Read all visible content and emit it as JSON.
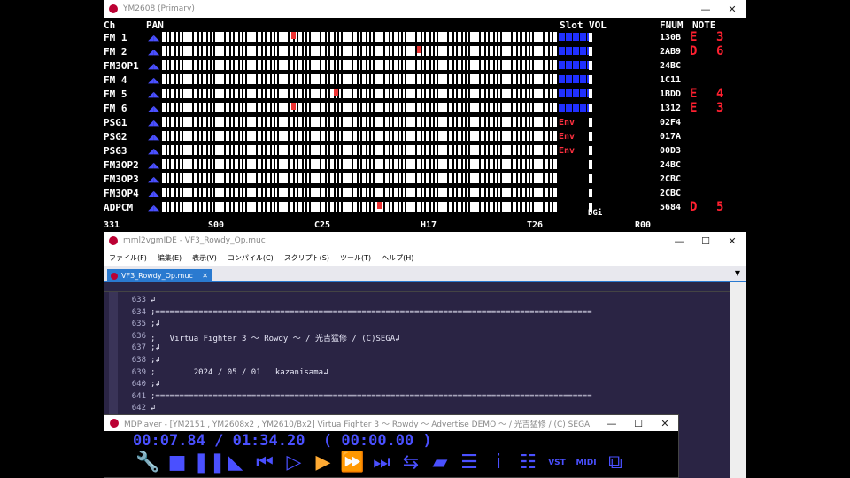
{
  "ym": {
    "title": "YM2608 (Primary)",
    "hdr_ch": "Ch",
    "hdr_pan": "PAN",
    "hdr_slot": "Slot",
    "hdr_vol": "VOL",
    "hdr_fnum": "FNUM",
    "hdr_note": "NOTE",
    "channels": [
      "FM 1",
      "FM 2",
      "FM3OP1",
      "FM 4",
      "FM 5",
      "FM 6",
      "PSG1",
      "PSG2",
      "PSG3",
      "FM3OP2",
      "FM3OP3",
      "FM3OP4",
      "ADPCM"
    ],
    "fnums": [
      "130B",
      "2AB9",
      "24BC",
      "1C11",
      "1BDD",
      "1312",
      "02F4",
      "017A",
      "00D3",
      "24BC",
      "2CBC",
      "2CBC",
      "5684"
    ],
    "notes": [
      "E",
      "D",
      "",
      "",
      "E",
      "E",
      "",
      "",
      "",
      "",
      "",
      "",
      "D"
    ],
    "octaves": [
      "3",
      "6",
      "",
      "",
      "4",
      "3",
      "",
      "",
      "",
      "",
      "",
      "",
      "5"
    ],
    "env": "Env",
    "dg": "DGi",
    "bottom": [
      "331",
      "S00",
      "C25",
      "H17",
      "T26",
      "R00"
    ]
  },
  "ide": {
    "title": "mml2vgmIDE - VF3_Rowdy_Op.muc",
    "menu": [
      "ファイル(F)",
      "編集(E)",
      "表示(V)",
      "コンパイル(C)",
      "スクリプト(S)",
      "ツール(T)",
      "ヘルプ(H)"
    ],
    "tab": "VF3_Rowdy_Op.muc",
    "lines": [
      {
        "n": "633",
        "t": "↲"
      },
      {
        "n": "634",
        "t": ";==========================================================================================="
      },
      {
        "n": "635",
        "t": ";↲"
      },
      {
        "n": "636",
        "t": ";   Virtua Fighter 3 ～ Rowdy ～ / 光吉猛修 / (C)SEGA↲"
      },
      {
        "n": "637",
        "t": ";↲"
      },
      {
        "n": "638",
        "t": ";↲"
      },
      {
        "n": "639",
        "t": ";        2024 / 05 / 01   kazanisama↲"
      },
      {
        "n": "640",
        "t": ";↲"
      },
      {
        "n": "641",
        "t": ";==========================================================================================="
      },
      {
        "n": "642",
        "t": "↲"
      }
    ]
  },
  "mdp": {
    "title": "MDPlayer - [YM2151 , YM2608x2 , YM2610/Bx2] Virtua Fighter 3 ～ Rowdy ～ Advertise DEMO ～ / 光吉猛修 / (C) SEGA",
    "time": "00:07.84 / 01:34.20  ( 00:00.00 )",
    "buttons": [
      "setting-icon",
      "stop-icon",
      "pause-icon",
      "fade-icon",
      "prev-icon",
      "slow-icon",
      "play-icon",
      "ff-icon",
      "next-icon",
      "repeat-icon",
      "open-icon",
      "playlist-icon",
      "info-icon",
      "mixer-icon",
      "vst-icon",
      "midi-kbd-icon",
      "zoom-icon"
    ]
  }
}
